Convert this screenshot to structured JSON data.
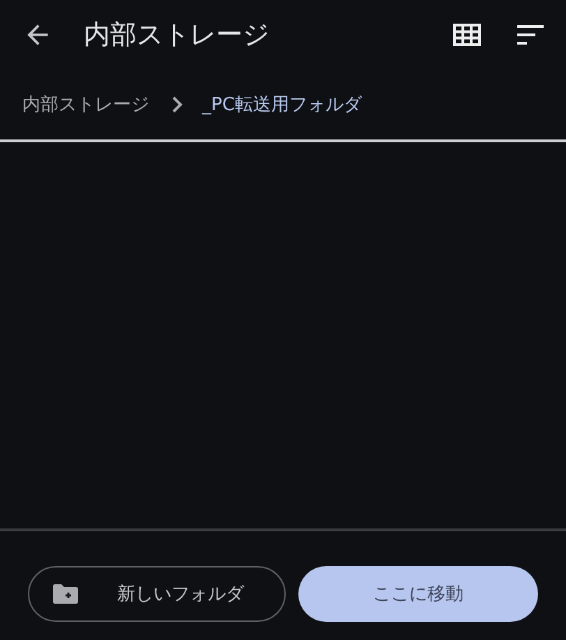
{
  "app_bar": {
    "title": "内部ストレージ"
  },
  "breadcrumbs": [
    {
      "label": "内部ストレージ",
      "selected": false
    },
    {
      "label": "_PC転送用フォルダ",
      "selected": true
    }
  ],
  "buttons": [
    {
      "label": "新しいフォルダ",
      "kind": "outlined"
    },
    {
      "label": "ここに移動",
      "kind": "filled"
    }
  ]
}
